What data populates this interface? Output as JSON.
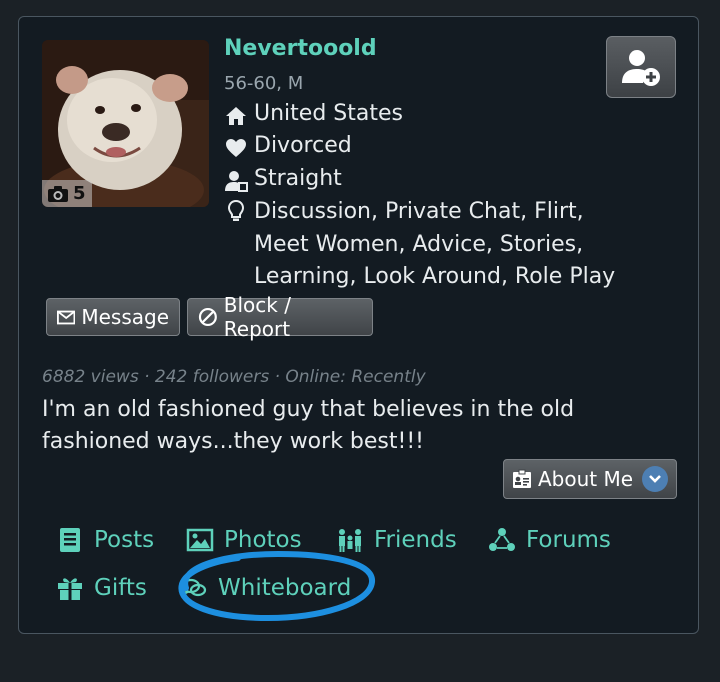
{
  "profile": {
    "username": "Nevertooold",
    "age_sex": "56-60, M",
    "photo_count": "5",
    "location": "United States",
    "relationship": "Divorced",
    "orientation": "Straight",
    "interests": "Discussion, Private Chat, Flirt, Meet Women, Advice, Stories, Learning, Look Around, Role Play"
  },
  "actions": {
    "message_label": "Message",
    "block_report_label": "Block / Report",
    "about_me_label": "About Me"
  },
  "stats": {
    "line": "6882 views · 242 followers · Online: Recently"
  },
  "bio": {
    "text": "I'm an old fashioned guy that believes in the old fashioned ways...they work best!!!"
  },
  "nav": {
    "posts": "Posts",
    "photos": "Photos",
    "friends": "Friends",
    "forums": "Forums",
    "gifts": "Gifts",
    "whiteboard": "Whiteboard"
  },
  "colors": {
    "accent": "#5ed1bb",
    "background": "#131b22",
    "annotation": "#1d8fe0"
  },
  "icons": [
    "camera-icon",
    "home-icon",
    "heart-icon",
    "orientation-icon",
    "lightbulb-icon",
    "add-friend-icon",
    "envelope-icon",
    "block-icon",
    "about-me-icon",
    "chevron-down-icon",
    "posts-icon",
    "photos-icon",
    "friends-icon",
    "forums-icon",
    "gifts-icon",
    "whiteboard-icon"
  ]
}
